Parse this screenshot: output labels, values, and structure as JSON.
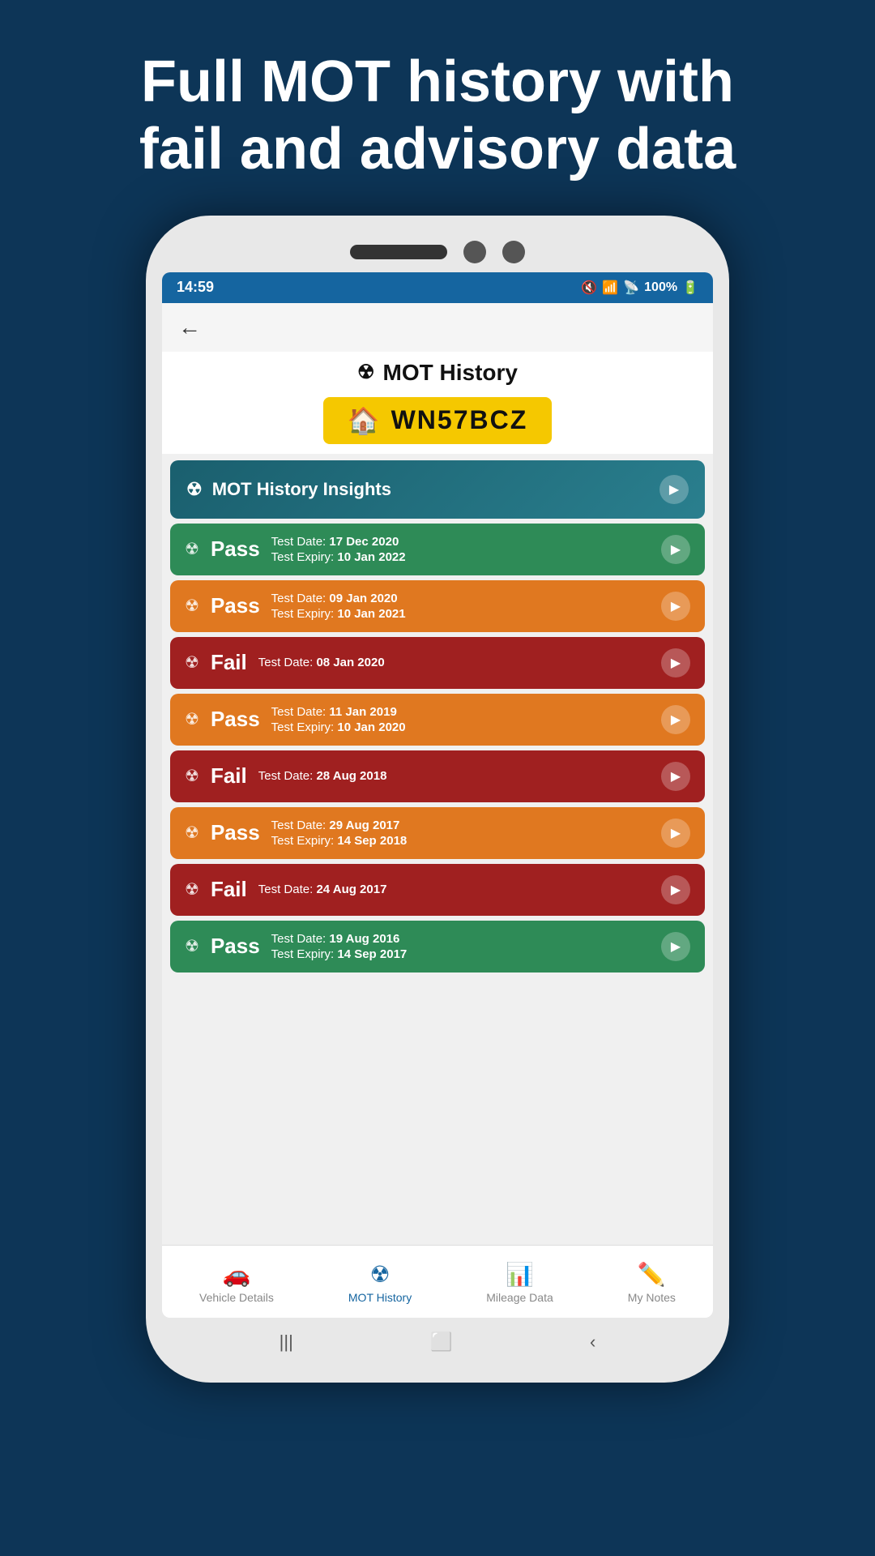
{
  "header": {
    "title_line1": "Full MOT history with",
    "title_line2": "fail and advisory data"
  },
  "status_bar": {
    "time": "14:59",
    "battery": "100%",
    "signal_icon": "📶",
    "wifi_icon": "📡"
  },
  "page_title": "MOT History",
  "plate": "WN57BCZ",
  "insights": {
    "label": "MOT History Insights"
  },
  "mot_records": [
    {
      "result": "Pass",
      "style": "pass-green",
      "test_date_label": "Test Date:",
      "test_date": "17 Dec 2020",
      "expiry_label": "Test Expiry:",
      "expiry": "10 Jan 2022"
    },
    {
      "result": "Pass",
      "style": "pass-orange",
      "test_date_label": "Test Date:",
      "test_date": "09 Jan 2020",
      "expiry_label": "Test Expiry:",
      "expiry": "10 Jan 2021"
    },
    {
      "result": "Fail",
      "style": "fail-red",
      "test_date_label": "Test Date:",
      "test_date": "08 Jan 2020",
      "expiry_label": null,
      "expiry": null
    },
    {
      "result": "Pass",
      "style": "pass-orange",
      "test_date_label": "Test Date:",
      "test_date": "11 Jan 2019",
      "expiry_label": "Test Expiry:",
      "expiry": "10 Jan 2020"
    },
    {
      "result": "Fail",
      "style": "fail-red",
      "test_date_label": "Test Date:",
      "test_date": "28 Aug 2018",
      "expiry_label": null,
      "expiry": null
    },
    {
      "result": "Pass",
      "style": "pass-orange",
      "test_date_label": "Test Date:",
      "test_date": "29 Aug 2017",
      "expiry_label": "Test Expiry:",
      "expiry": "14 Sep 2018"
    },
    {
      "result": "Fail",
      "style": "fail-red",
      "test_date_label": "Test Date:",
      "test_date": "24 Aug 2017",
      "expiry_label": null,
      "expiry": null
    },
    {
      "result": "Pass",
      "style": "pass-green",
      "test_date_label": "Test Date:",
      "test_date": "19 Aug 2016",
      "expiry_label": "Test Expiry:",
      "expiry": "14 Sep 2017"
    }
  ],
  "bottom_nav": {
    "items": [
      {
        "label": "Vehicle Details",
        "icon": "🚗",
        "active": false
      },
      {
        "label": "MOT History",
        "icon": "☢",
        "active": true
      },
      {
        "label": "Mileage Data",
        "icon": "📊",
        "active": false
      },
      {
        "label": "My Notes",
        "icon": "✏️",
        "active": false
      }
    ]
  }
}
